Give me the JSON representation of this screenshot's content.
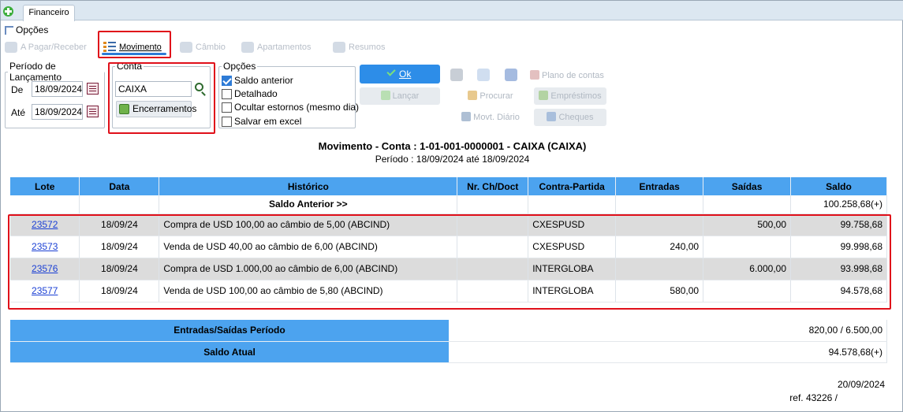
{
  "tab": {
    "title": "Financeiro"
  },
  "menu": {
    "opcoes": "Opções"
  },
  "toolbar": {
    "pagar_receber": "A Pagar/Receber",
    "movimento": "Movimento",
    "cambio": "Câmbio",
    "apartamentos": "Apartamentos",
    "resumos": "Resumos"
  },
  "periodo": {
    "legend": "Período de Lançamento",
    "de_label": "De",
    "de_value": "18/09/2024",
    "ate_label": "Até",
    "ate_value": "18/09/2024"
  },
  "conta": {
    "legend": "Conta",
    "value": "CAIXA",
    "encerramentos": "Encerramentos"
  },
  "opcoes": {
    "legend": "Opções",
    "items": [
      {
        "label": "Saldo anterior",
        "checked": true
      },
      {
        "label": "Detalhado",
        "checked": false
      },
      {
        "label": "Ocultar estornos (mesmo dia)",
        "checked": false
      },
      {
        "label": "Salvar em excel",
        "checked": false
      }
    ]
  },
  "actions": {
    "ok": "Ok",
    "lancar": "Lançar",
    "procurar": "Procurar",
    "mov_diario": "Movt. Diário",
    "plano_contas": "Plano de contas",
    "emprestimos": "Empréstimos",
    "cheques": "Cheques"
  },
  "report": {
    "title": "Movimento - Conta : 1-01-001-0000001 - CAIXA (CAIXA)",
    "subtitle": "Período : 18/09/2024 até 18/09/2024",
    "columns": [
      "Lote",
      "Data",
      "Histórico",
      "Nr. Ch/Doct",
      "Contra-Partida",
      "Entradas",
      "Saídas",
      "Saldo"
    ],
    "saldo_anterior_label": "Saldo Anterior >>",
    "saldo_anterior_value": "100.258,68(+)",
    "rows": [
      {
        "lote": "23572",
        "data": "18/09/24",
        "historico": "Compra de USD 100,00 ao câmbio de 5,00 (ABCIND)",
        "doc": "",
        "contra": "CXESPUSD",
        "entradas": "",
        "saidas": "500,00",
        "saldo": "99.758,68"
      },
      {
        "lote": "23573",
        "data": "18/09/24",
        "historico": "Venda de USD 40,00 ao câmbio de 6,00 (ABCIND)",
        "doc": "",
        "contra": "CXESPUSD",
        "entradas": "240,00",
        "saidas": "",
        "saldo": "99.998,68"
      },
      {
        "lote": "23576",
        "data": "18/09/24",
        "historico": "Compra de USD 1.000,00 ao câmbio de 6,00 (ABCIND)",
        "doc": "",
        "contra": "INTERGLOBA",
        "entradas": "",
        "saidas": "6.000,00",
        "saldo": "93.998,68"
      },
      {
        "lote": "23577",
        "data": "18/09/24",
        "historico": "Venda de USD 100,00 ao câmbio de 5,80 (ABCIND)",
        "doc": "",
        "contra": "INTERGLOBA",
        "entradas": "580,00",
        "saidas": "",
        "saldo": "94.578,68"
      }
    ],
    "totals": {
      "entradas_saidas_label": "Entradas/Saídas Período",
      "entradas_saidas_value": "820,00 / 6.500,00",
      "saldo_atual_label": "Saldo Atual",
      "saldo_atual_value": "94.578,68(+)"
    },
    "footer_date": "20/09/2024",
    "footer_ref": "ref. 43226 /"
  },
  "colors": {
    "accent": "#2d8de8",
    "header": "#4ca3ef",
    "highlight": "#e0101a"
  }
}
